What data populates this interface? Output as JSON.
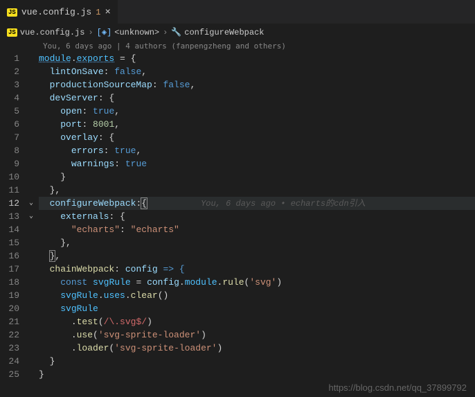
{
  "tab": {
    "icon": "JS",
    "name": "vue.config.js",
    "modified": "1"
  },
  "breadcrumbs": {
    "file_icon": "JS",
    "file": "vue.config.js",
    "sep": "›",
    "seg1": "<unknown>",
    "seg2": "configureWebpack"
  },
  "codelens": "You, 6 days ago | 4 authors (fanpengzheng and others)",
  "lines": {
    "count": 25,
    "active": 12
  },
  "code": {
    "l1": {
      "a": "module",
      "b": ".",
      "c": "exports",
      "d": " = {"
    },
    "l2": {
      "a": "lintOnSave",
      "b": ": ",
      "c": "false",
      "d": ","
    },
    "l3": {
      "a": "productionSourceMap",
      "b": ": ",
      "c": "false",
      "d": ","
    },
    "l4": {
      "a": "devServer",
      "b": ": {"
    },
    "l5": {
      "a": "open",
      "b": ": ",
      "c": "true",
      "d": ","
    },
    "l6": {
      "a": "port",
      "b": ": ",
      "c": "8001",
      "d": ","
    },
    "l7": {
      "a": "overlay",
      "b": ": {"
    },
    "l8": {
      "a": "errors",
      "b": ": ",
      "c": "true",
      "d": ","
    },
    "l9": {
      "a": "warnings",
      "b": ": ",
      "c": "true"
    },
    "l10": "}",
    "l11": "},",
    "l12": {
      "a": "configureWebpack",
      "b": ":",
      "c": "{",
      "blame": "You, 6 days ago • echarts的cdn引入"
    },
    "l13": {
      "a": "externals",
      "b": ": {"
    },
    "l14": {
      "a": "\"echarts\"",
      "b": ": ",
      "c": "\"echarts\""
    },
    "l15": "},",
    "l16": {
      "a": "}",
      "b": ","
    },
    "l17": {
      "a": "chainWebpack",
      "b": ": ",
      "c": "config",
      "d": " => {"
    },
    "l18": {
      "a": "const",
      "b": " ",
      "c": "svgRule",
      "d": " = ",
      "e": "config",
      "f": ".",
      "g": "module",
      "h": ".",
      "i": "rule",
      "j": "(",
      "k": "'svg'",
      "l": ")"
    },
    "l19": {
      "a": "svgRule",
      "b": ".",
      "c": "uses",
      "d": ".",
      "e": "clear",
      "f": "()"
    },
    "l20": "svgRule",
    "l21": {
      "a": ".",
      "b": "test",
      "c": "(",
      "d": "/\\.svg$/",
      "e": ")"
    },
    "l22": {
      "a": ".",
      "b": "use",
      "c": "(",
      "d": "'svg-sprite-loader'",
      "e": ")"
    },
    "l23": {
      "a": ".",
      "b": "loader",
      "c": "(",
      "d": "'svg-sprite-loader'",
      "e": ")"
    },
    "l24": "}",
    "l25": "}"
  },
  "watermark": "https://blog.csdn.net/qq_37899792"
}
